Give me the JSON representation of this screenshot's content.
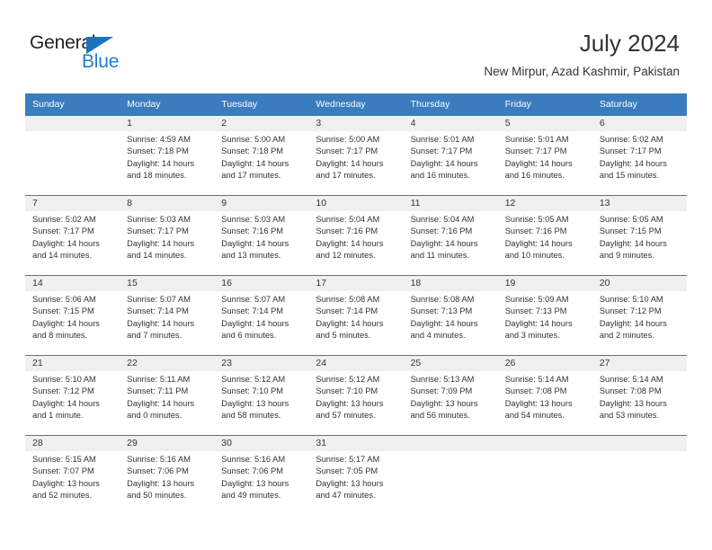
{
  "brand": {
    "name_part1": "General",
    "name_part2": "Blue",
    "triangle_icon": "triangle-icon",
    "color_dark": "#231f20",
    "color_blue": "#2180cb"
  },
  "header": {
    "title": "July 2024",
    "subtitle": "New Mirpur, Azad Kashmir, Pakistan"
  },
  "theme": {
    "header_bg": "#3a7cbe",
    "daynum_bg": "#f0f0f0",
    "text": "#333333"
  },
  "weekdays": [
    "Sunday",
    "Monday",
    "Tuesday",
    "Wednesday",
    "Thursday",
    "Friday",
    "Saturday"
  ],
  "weeks": [
    [
      {
        "day": "",
        "sunrise": "",
        "sunset": "",
        "daylight1": "",
        "daylight2": "",
        "blank": true
      },
      {
        "day": "1",
        "sunrise": "Sunrise: 4:59 AM",
        "sunset": "Sunset: 7:18 PM",
        "daylight1": "Daylight: 14 hours",
        "daylight2": "and 18 minutes."
      },
      {
        "day": "2",
        "sunrise": "Sunrise: 5:00 AM",
        "sunset": "Sunset: 7:18 PM",
        "daylight1": "Daylight: 14 hours",
        "daylight2": "and 17 minutes."
      },
      {
        "day": "3",
        "sunrise": "Sunrise: 5:00 AM",
        "sunset": "Sunset: 7:17 PM",
        "daylight1": "Daylight: 14 hours",
        "daylight2": "and 17 minutes."
      },
      {
        "day": "4",
        "sunrise": "Sunrise: 5:01 AM",
        "sunset": "Sunset: 7:17 PM",
        "daylight1": "Daylight: 14 hours",
        "daylight2": "and 16 minutes."
      },
      {
        "day": "5",
        "sunrise": "Sunrise: 5:01 AM",
        "sunset": "Sunset: 7:17 PM",
        "daylight1": "Daylight: 14 hours",
        "daylight2": "and 16 minutes."
      },
      {
        "day": "6",
        "sunrise": "Sunrise: 5:02 AM",
        "sunset": "Sunset: 7:17 PM",
        "daylight1": "Daylight: 14 hours",
        "daylight2": "and 15 minutes."
      }
    ],
    [
      {
        "day": "7",
        "sunrise": "Sunrise: 5:02 AM",
        "sunset": "Sunset: 7:17 PM",
        "daylight1": "Daylight: 14 hours",
        "daylight2": "and 14 minutes."
      },
      {
        "day": "8",
        "sunrise": "Sunrise: 5:03 AM",
        "sunset": "Sunset: 7:17 PM",
        "daylight1": "Daylight: 14 hours",
        "daylight2": "and 14 minutes."
      },
      {
        "day": "9",
        "sunrise": "Sunrise: 5:03 AM",
        "sunset": "Sunset: 7:16 PM",
        "daylight1": "Daylight: 14 hours",
        "daylight2": "and 13 minutes."
      },
      {
        "day": "10",
        "sunrise": "Sunrise: 5:04 AM",
        "sunset": "Sunset: 7:16 PM",
        "daylight1": "Daylight: 14 hours",
        "daylight2": "and 12 minutes."
      },
      {
        "day": "11",
        "sunrise": "Sunrise: 5:04 AM",
        "sunset": "Sunset: 7:16 PM",
        "daylight1": "Daylight: 14 hours",
        "daylight2": "and 11 minutes."
      },
      {
        "day": "12",
        "sunrise": "Sunrise: 5:05 AM",
        "sunset": "Sunset: 7:16 PM",
        "daylight1": "Daylight: 14 hours",
        "daylight2": "and 10 minutes."
      },
      {
        "day": "13",
        "sunrise": "Sunrise: 5:05 AM",
        "sunset": "Sunset: 7:15 PM",
        "daylight1": "Daylight: 14 hours",
        "daylight2": "and 9 minutes."
      }
    ],
    [
      {
        "day": "14",
        "sunrise": "Sunrise: 5:06 AM",
        "sunset": "Sunset: 7:15 PM",
        "daylight1": "Daylight: 14 hours",
        "daylight2": "and 8 minutes."
      },
      {
        "day": "15",
        "sunrise": "Sunrise: 5:07 AM",
        "sunset": "Sunset: 7:14 PM",
        "daylight1": "Daylight: 14 hours",
        "daylight2": "and 7 minutes."
      },
      {
        "day": "16",
        "sunrise": "Sunrise: 5:07 AM",
        "sunset": "Sunset: 7:14 PM",
        "daylight1": "Daylight: 14 hours",
        "daylight2": "and 6 minutes."
      },
      {
        "day": "17",
        "sunrise": "Sunrise: 5:08 AM",
        "sunset": "Sunset: 7:14 PM",
        "daylight1": "Daylight: 14 hours",
        "daylight2": "and 5 minutes."
      },
      {
        "day": "18",
        "sunrise": "Sunrise: 5:08 AM",
        "sunset": "Sunset: 7:13 PM",
        "daylight1": "Daylight: 14 hours",
        "daylight2": "and 4 minutes."
      },
      {
        "day": "19",
        "sunrise": "Sunrise: 5:09 AM",
        "sunset": "Sunset: 7:13 PM",
        "daylight1": "Daylight: 14 hours",
        "daylight2": "and 3 minutes."
      },
      {
        "day": "20",
        "sunrise": "Sunrise: 5:10 AM",
        "sunset": "Sunset: 7:12 PM",
        "daylight1": "Daylight: 14 hours",
        "daylight2": "and 2 minutes."
      }
    ],
    [
      {
        "day": "21",
        "sunrise": "Sunrise: 5:10 AM",
        "sunset": "Sunset: 7:12 PM",
        "daylight1": "Daylight: 14 hours",
        "daylight2": "and 1 minute."
      },
      {
        "day": "22",
        "sunrise": "Sunrise: 5:11 AM",
        "sunset": "Sunset: 7:11 PM",
        "daylight1": "Daylight: 14 hours",
        "daylight2": "and 0 minutes."
      },
      {
        "day": "23",
        "sunrise": "Sunrise: 5:12 AM",
        "sunset": "Sunset: 7:10 PM",
        "daylight1": "Daylight: 13 hours",
        "daylight2": "and 58 minutes."
      },
      {
        "day": "24",
        "sunrise": "Sunrise: 5:12 AM",
        "sunset": "Sunset: 7:10 PM",
        "daylight1": "Daylight: 13 hours",
        "daylight2": "and 57 minutes."
      },
      {
        "day": "25",
        "sunrise": "Sunrise: 5:13 AM",
        "sunset": "Sunset: 7:09 PM",
        "daylight1": "Daylight: 13 hours",
        "daylight2": "and 56 minutes."
      },
      {
        "day": "26",
        "sunrise": "Sunrise: 5:14 AM",
        "sunset": "Sunset: 7:08 PM",
        "daylight1": "Daylight: 13 hours",
        "daylight2": "and 54 minutes."
      },
      {
        "day": "27",
        "sunrise": "Sunrise: 5:14 AM",
        "sunset": "Sunset: 7:08 PM",
        "daylight1": "Daylight: 13 hours",
        "daylight2": "and 53 minutes."
      }
    ],
    [
      {
        "day": "28",
        "sunrise": "Sunrise: 5:15 AM",
        "sunset": "Sunset: 7:07 PM",
        "daylight1": "Daylight: 13 hours",
        "daylight2": "and 52 minutes."
      },
      {
        "day": "29",
        "sunrise": "Sunrise: 5:16 AM",
        "sunset": "Sunset: 7:06 PM",
        "daylight1": "Daylight: 13 hours",
        "daylight2": "and 50 minutes."
      },
      {
        "day": "30",
        "sunrise": "Sunrise: 5:16 AM",
        "sunset": "Sunset: 7:06 PM",
        "daylight1": "Daylight: 13 hours",
        "daylight2": "and 49 minutes."
      },
      {
        "day": "31",
        "sunrise": "Sunrise: 5:17 AM",
        "sunset": "Sunset: 7:05 PM",
        "daylight1": "Daylight: 13 hours",
        "daylight2": "and 47 minutes."
      },
      {
        "day": "",
        "sunrise": "",
        "sunset": "",
        "daylight1": "",
        "daylight2": "",
        "blank": true
      },
      {
        "day": "",
        "sunrise": "",
        "sunset": "",
        "daylight1": "",
        "daylight2": "",
        "blank": true
      },
      {
        "day": "",
        "sunrise": "",
        "sunset": "",
        "daylight1": "",
        "daylight2": "",
        "blank": true
      }
    ]
  ]
}
